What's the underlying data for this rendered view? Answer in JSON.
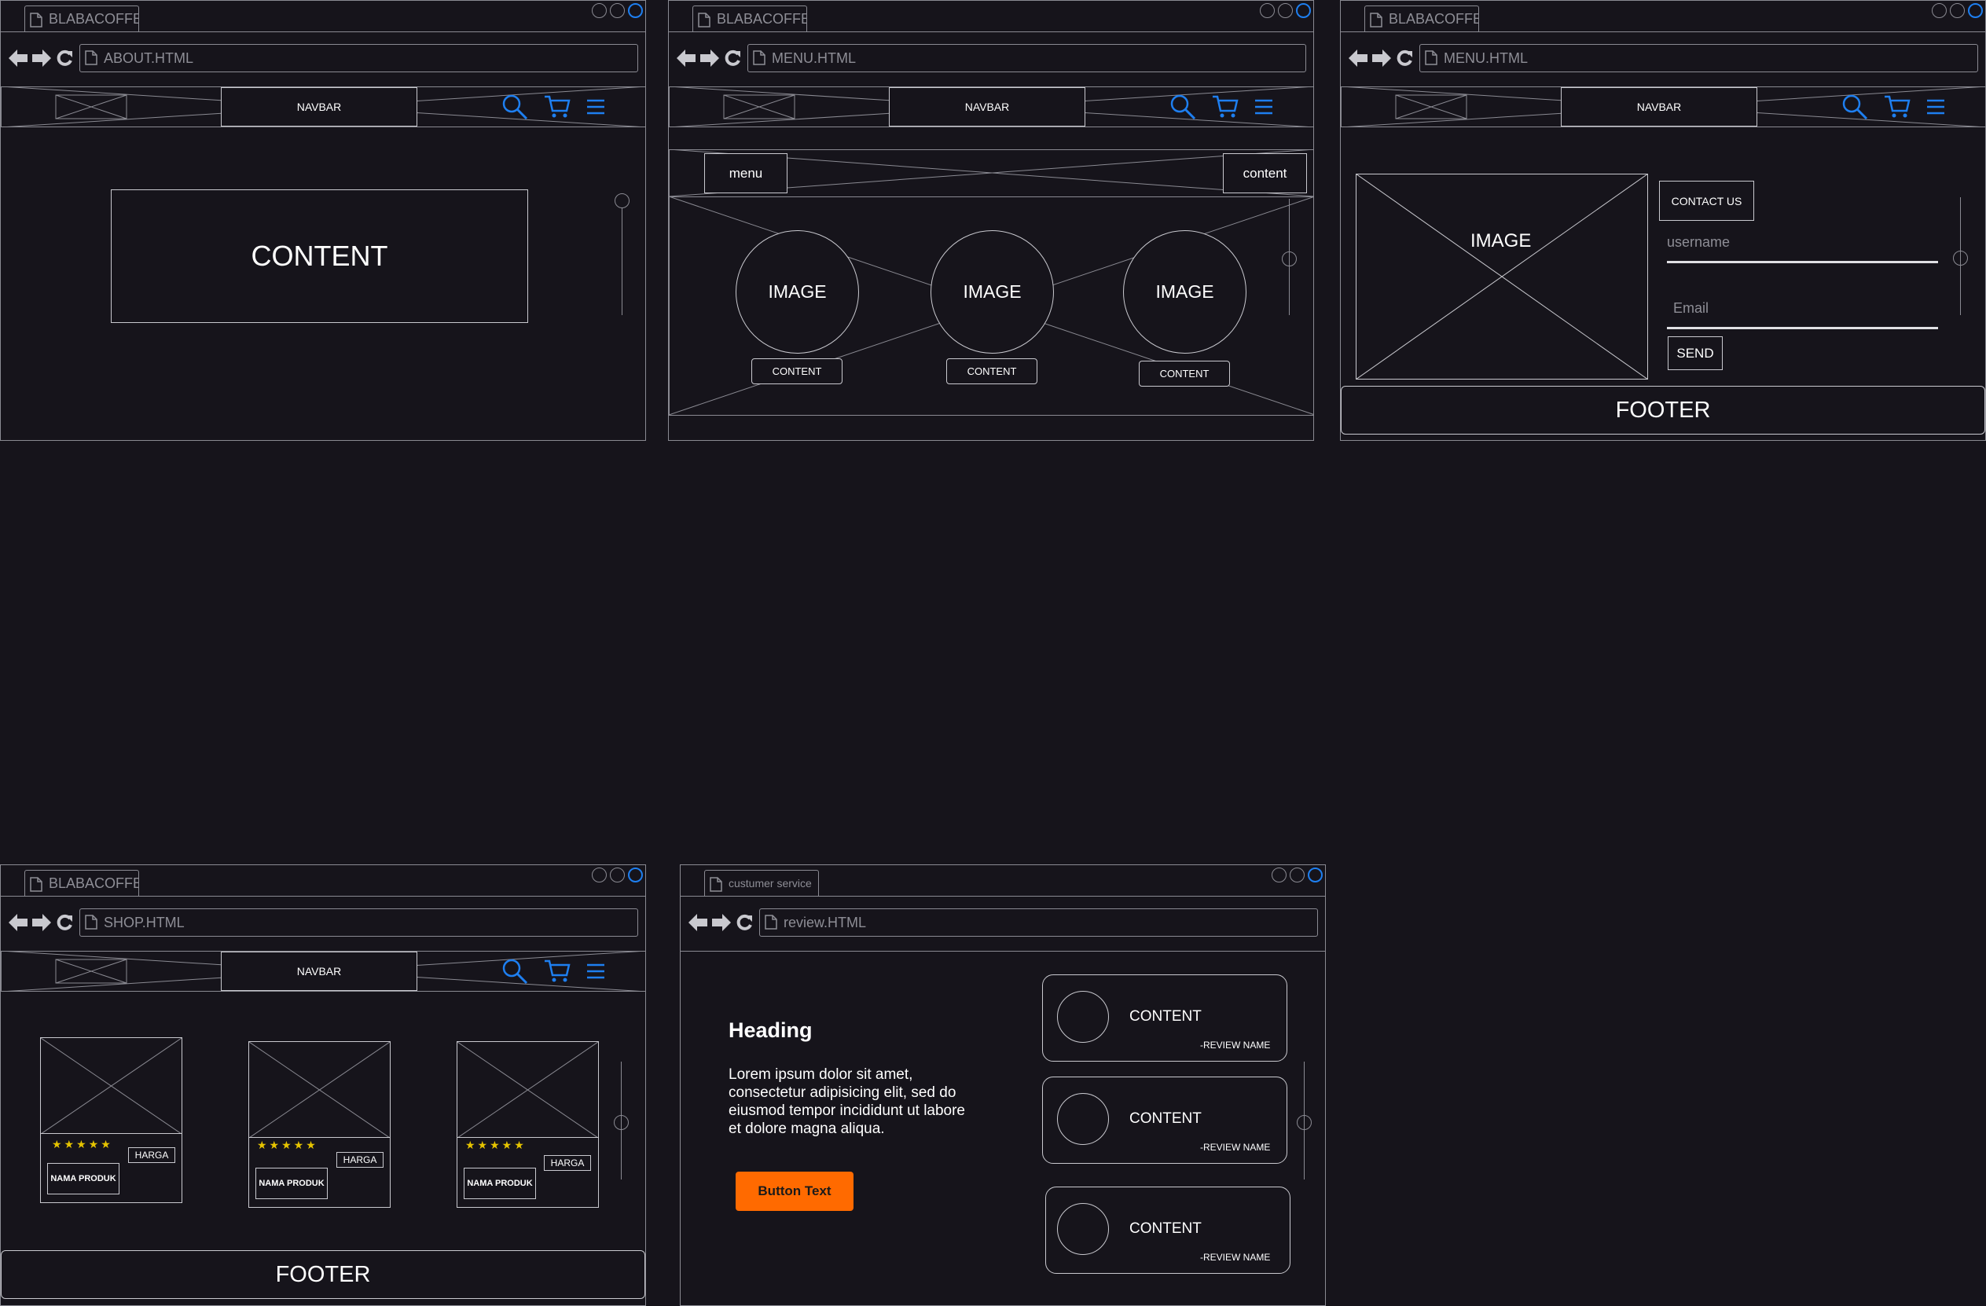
{
  "common": {
    "tab_title": "BLABACOFFE",
    "navbar_label": "NAVBAR"
  },
  "about": {
    "url": "ABOUT.HTML",
    "content": "CONTENT"
  },
  "menu": {
    "url": "MENU.HTML",
    "menu_btn": "menu",
    "content_btn": "content",
    "cards": [
      {
        "image": "IMAGE",
        "content": "CONTENT"
      },
      {
        "image": "IMAGE",
        "content": "CONTENT"
      },
      {
        "image": "IMAGE",
        "content": "CONTENT"
      }
    ]
  },
  "contact": {
    "url": "MENU.HTML",
    "image": "IMAGE",
    "contact_us": "CONTACT US",
    "username_placeholder": "username",
    "email_placeholder": "Email",
    "send": "SEND",
    "footer": "FOOTER"
  },
  "shop": {
    "url": "SHOP.HTML",
    "footer": "FOOTER",
    "products": [
      {
        "stars": "★★★★★",
        "price": "HARGA",
        "name": "NAMA PRODUK"
      },
      {
        "stars": "★★★★★",
        "price": "HARGA",
        "name": "NAMA PRODUK"
      },
      {
        "stars": "★★★★★",
        "price": "HARGA",
        "name": "NAMA PRODUK"
      }
    ]
  },
  "review": {
    "tab_title": "custumer service",
    "url": "review.HTML",
    "heading": "Heading",
    "body_lines": [
      "Lorem ipsum dolor sit amet,",
      "consectetur adipisicing elit, sed do",
      "eiusmod tempor incididunt ut labore",
      "et dolore magna aliqua."
    ],
    "button": "Button Text",
    "cards": [
      {
        "content": "CONTENT",
        "name": "-REVIEW NAME"
      },
      {
        "content": "CONTENT",
        "name": "-REVIEW NAME"
      },
      {
        "content": "CONTENT",
        "name": "-REVIEW NAME"
      }
    ]
  },
  "colors": {
    "accent_blue": "#1e7ff0",
    "button_orange": "#ff6a00",
    "star": "#e6c400"
  }
}
